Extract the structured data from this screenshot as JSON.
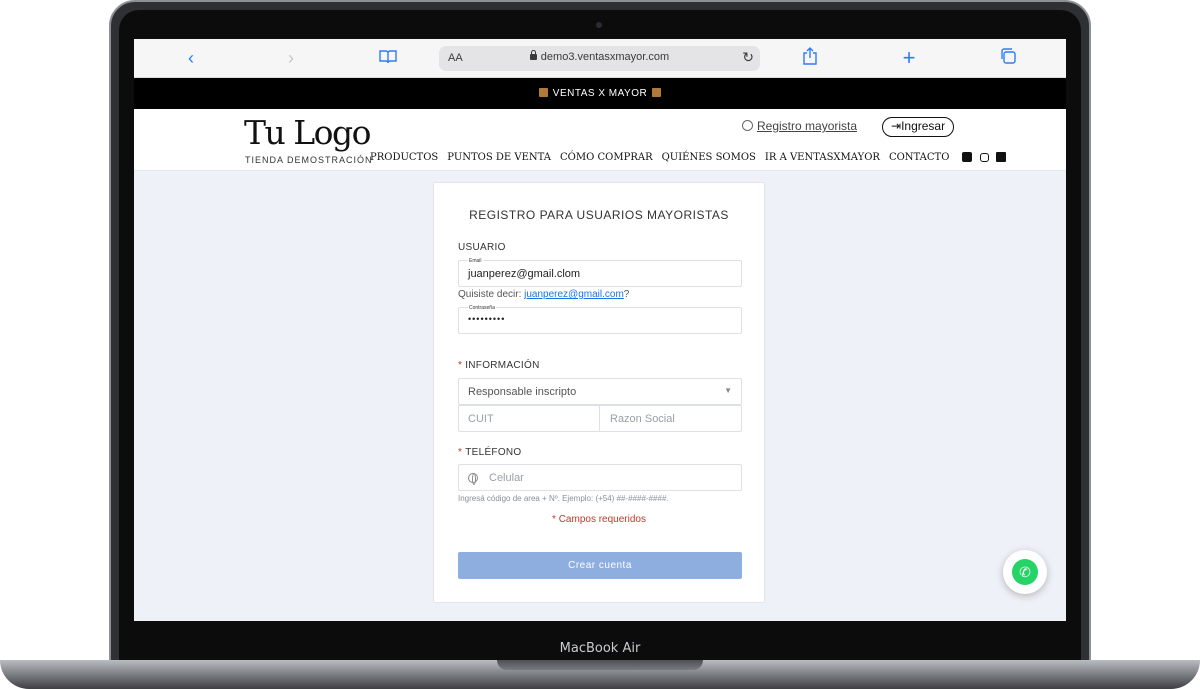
{
  "device": {
    "label": "MacBook Air"
  },
  "browser": {
    "aa_label": "AA",
    "url": "demo3.ventasxmayor.com",
    "icons": {
      "back": "chevron-left-icon",
      "forward": "chevron-right-icon",
      "bookmarks": "book-icon",
      "reload": "reload-icon",
      "share": "share-icon",
      "new_tab": "plus-icon",
      "tabs": "tabs-icon"
    },
    "accent_color": "#2f7cf6"
  },
  "promo": {
    "text": "VENTAS X MAYOR"
  },
  "header": {
    "logo": "Tu Logo",
    "logo_sub": "TIENDA DEMOSTRACIÓN",
    "register_link": "Registro mayorista",
    "login_button": "Ingresar",
    "nav": [
      "PRODUCTOS",
      "PUNTOS DE VENTA",
      "CÓMO COMPRAR",
      "QUIÉNES SOMOS",
      "IR A VENTASXMAYOR",
      "CONTACTO"
    ],
    "social_icons": [
      "facebook-icon",
      "instagram-icon",
      "youtube-icon"
    ]
  },
  "form": {
    "title": "REGISTRO PARA USUARIOS MAYORISTAS",
    "user_section": "USUARIO",
    "email_label": "Email",
    "email_value": "juanperez@gmail.clom",
    "suggestion_prefix": "Quisiste decir: ",
    "suggestion_link": "juanperez@gmail.com",
    "suggestion_suffix": "?",
    "password_label": "Contraseña",
    "password_value": "•••••••••",
    "info_section": "INFORMACIÓN",
    "tax_select_value": "Responsable inscripto",
    "cuit_placeholder": "CUIT",
    "razon_placeholder": "Razon Social",
    "phone_section": "TELÉFONO",
    "phone_placeholder": "Celular",
    "phone_hint": "Ingresá código de area + Nº. Ejemplo: (+54) ##-####-####.",
    "required_note": "* Campos requeridos",
    "submit_label": "Crear cuenta",
    "submit_color": "#8faee0",
    "required_color": "#c0392b"
  },
  "whatsapp": {
    "icon": "whatsapp-icon",
    "color": "#25d366"
  }
}
